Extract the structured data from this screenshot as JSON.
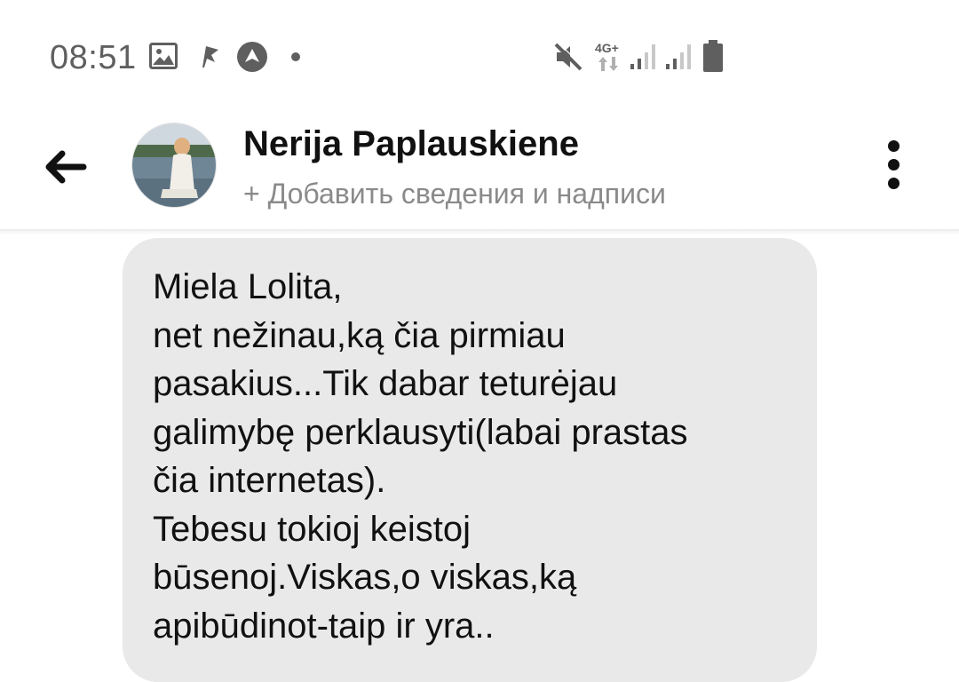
{
  "status_bar": {
    "time": "08:51",
    "network_label": "4G+",
    "icons": [
      "image-icon",
      "flag-icon",
      "navigation-icon",
      "dot-icon",
      "mute-icon",
      "data-arrows-icon",
      "signal-icon",
      "signal-icon",
      "battery-icon"
    ]
  },
  "header": {
    "contact_name": "Nerija Paplauskiene",
    "subtitle": "+ Добавить сведения и надписи",
    "icons": [
      "back-arrow-icon",
      "more-vertical-icon"
    ]
  },
  "message": {
    "lines": [
      "Miela Lolita,",
      "net nežinau,ką čia pirmiau",
      "pasakius...Tik dabar teturėjau",
      "galimybę perklausyti(labai prastas",
      "čia internetas).",
      "Tebesu tokioj keistoj",
      "būsenoj.Viskas,o viskas,ką",
      "apibūdinot-taip ir yra.."
    ]
  },
  "colors": {
    "bubble_bg": "#e9e9e9",
    "text_primary": "#111111",
    "text_secondary": "#8a8a8a",
    "status_text": "#5f5f5f"
  }
}
